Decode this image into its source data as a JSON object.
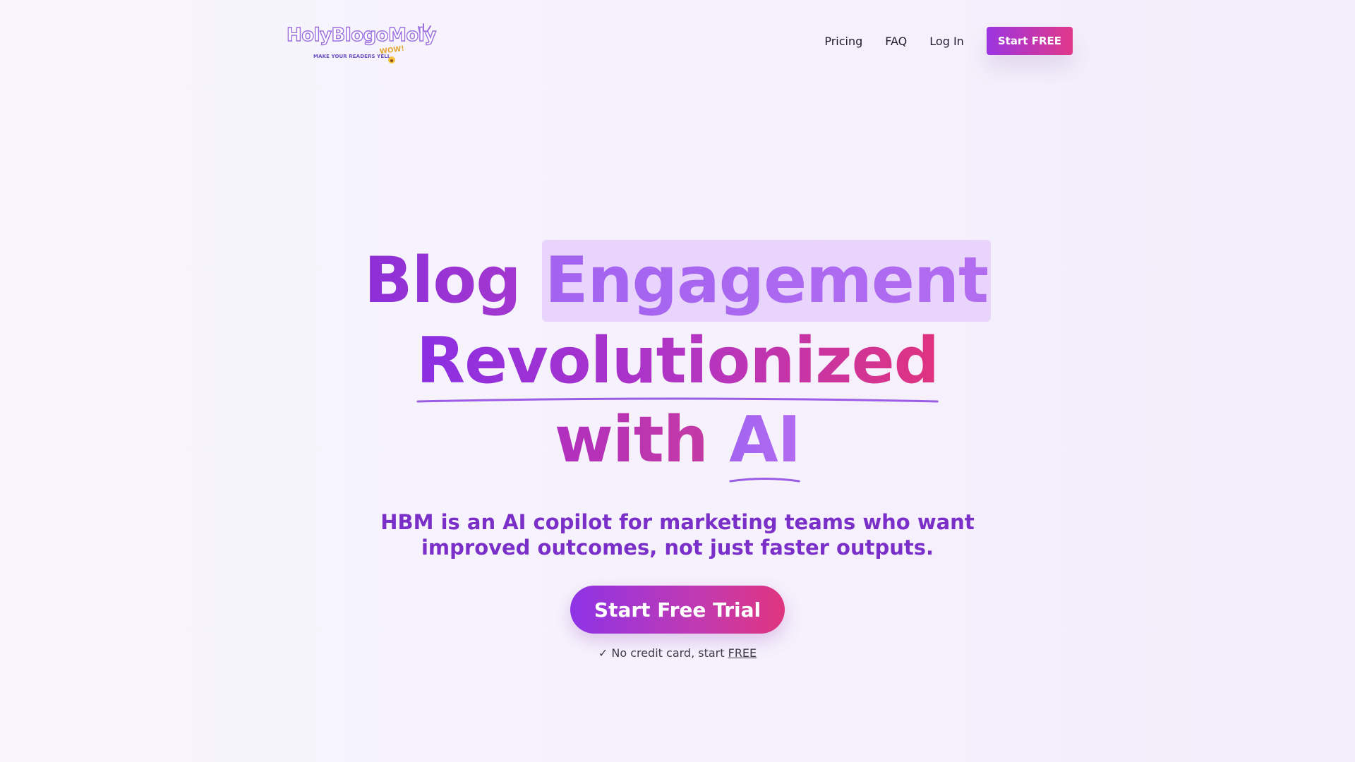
{
  "brand": {
    "logo_text": "HolyBlogoMoly",
    "tagline": "MAKE YOUR READERS YELL",
    "exclaim": "WOW!"
  },
  "nav": {
    "links": [
      "Pricing",
      "FAQ",
      "Log In"
    ],
    "cta_label": "Start FREE"
  },
  "hero": {
    "headline_word1": "Blog",
    "headline_word2": "Engagement",
    "headline_line2": "Revolutionized",
    "headline_word3": "with",
    "headline_word4": "AI",
    "subheading": "HBM is an AI copilot for marketing teams who want improved outcomes, not just faster outputs.",
    "cta_label": "Start Free Trial",
    "note_check": "✓",
    "note_text": "No credit card, start",
    "note_link": "FREE"
  },
  "colors": {
    "primary": "#9c35e0",
    "accent": "#e0388a",
    "highlight": "#e9d5fb"
  }
}
